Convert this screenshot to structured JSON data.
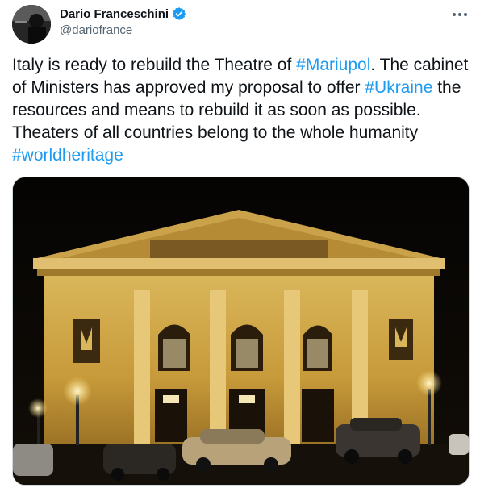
{
  "author": {
    "name": "Dario Franceschini",
    "handle": "@dariofrance",
    "verified": true
  },
  "icons": {
    "avatar": "avatar-photo",
    "verified": "verified-badge-icon",
    "more": "more-options-icon"
  },
  "colors": {
    "link": "#1d9bf0",
    "text": "#0f1419",
    "secondary": "#536471",
    "verified": "#1d9bf0"
  },
  "tweet": {
    "segments": [
      {
        "text": "Italy is ready to rebuild the Theatre of ",
        "tag": false
      },
      {
        "text": "#Mariupol",
        "tag": true
      },
      {
        "text": ". The cabinet of Ministers has approved my proposal to offer ",
        "tag": false
      },
      {
        "text": "#Ukraine",
        "tag": true
      },
      {
        "text": " the resources and means to  rebuild it as soon as possible. Theaters of all countries belong to the whole humanity ",
        "tag": false
      },
      {
        "text": "#worldheritage",
        "tag": true
      }
    ]
  },
  "media": {
    "kind": "photo"
  }
}
